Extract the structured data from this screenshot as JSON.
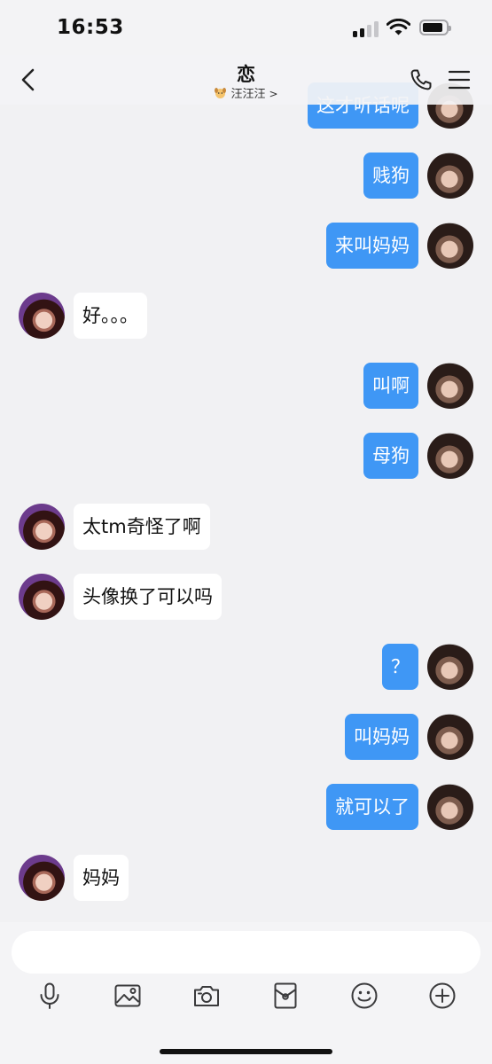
{
  "status_bar": {
    "time": "16:53"
  },
  "header": {
    "title": "恋",
    "subtitle": "汪汪汪",
    "subtitle_arrow": ">"
  },
  "messages": [
    {
      "side": "out",
      "text": "这才听话呢"
    },
    {
      "side": "out",
      "text": "贱狗"
    },
    {
      "side": "out",
      "text": "来叫妈妈"
    },
    {
      "side": "in",
      "text": "好。。。"
    },
    {
      "side": "out",
      "text": "叫啊"
    },
    {
      "side": "out",
      "text": "母狗"
    },
    {
      "side": "in",
      "text": "太tm奇怪了啊"
    },
    {
      "side": "in",
      "text": "头像换了可以吗"
    },
    {
      "side": "out",
      "text": "？"
    },
    {
      "side": "out",
      "text": "叫妈妈"
    },
    {
      "side": "out",
      "text": "就可以了"
    },
    {
      "side": "in",
      "text": "妈妈"
    }
  ],
  "input": {
    "value": "",
    "placeholder": ""
  },
  "toolbar_icons": [
    "microphone-icon",
    "image-icon",
    "camera-icon",
    "red-packet-icon",
    "emoji-icon",
    "plus-icon"
  ],
  "colors": {
    "outgoing_bubble": "#3f97f5",
    "incoming_bubble": "#ffffff",
    "background": "#f1f1f3",
    "accent_text": "#ffffff"
  }
}
